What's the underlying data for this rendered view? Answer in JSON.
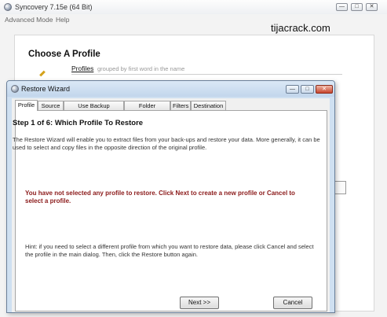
{
  "main_window": {
    "title": "Syncovery 7.15e (64 Bit)",
    "menu": [
      "Advanced Mode",
      "Help"
    ],
    "controls": {
      "minimize": "—",
      "maximize": "□",
      "close": "✕"
    }
  },
  "watermark": "tijacrack.com",
  "choose_profile": {
    "title": "Choose A Profile",
    "profiles_label": "Profiles",
    "profiles_hint": "grouped by first word in the name"
  },
  "dialog": {
    "title": "Restore Wizard",
    "controls": {
      "minimize": "—",
      "maximize": "□",
      "close": "✕"
    },
    "tabs": [
      "Profile",
      "Source",
      "Use Backup Database",
      "Folder Selection",
      "Filters",
      "Destination"
    ],
    "active_tab": 0,
    "step_title": "Step 1 of 6: Which Profile To Restore",
    "intro": "The Restore Wizard will enable you to extract files from your back-ups and restore your data. More generally, it can be used to select and copy files in the opposite direction of the original profile.",
    "warning": "You have not selected any profile to restore. Click Next to create a new profile or Cancel to select a profile.",
    "hint": "Hint: if you need to select a different profile from which you want to restore data, please click Cancel and select the profile in the main dialog. Then, click the Restore button again.",
    "buttons": {
      "next": "Next >>",
      "cancel": "Cancel"
    }
  },
  "colors": {
    "warning_text": "#8b1a1a",
    "dialog_frame": "#cfe0f1",
    "close_button": "#c8452d"
  }
}
